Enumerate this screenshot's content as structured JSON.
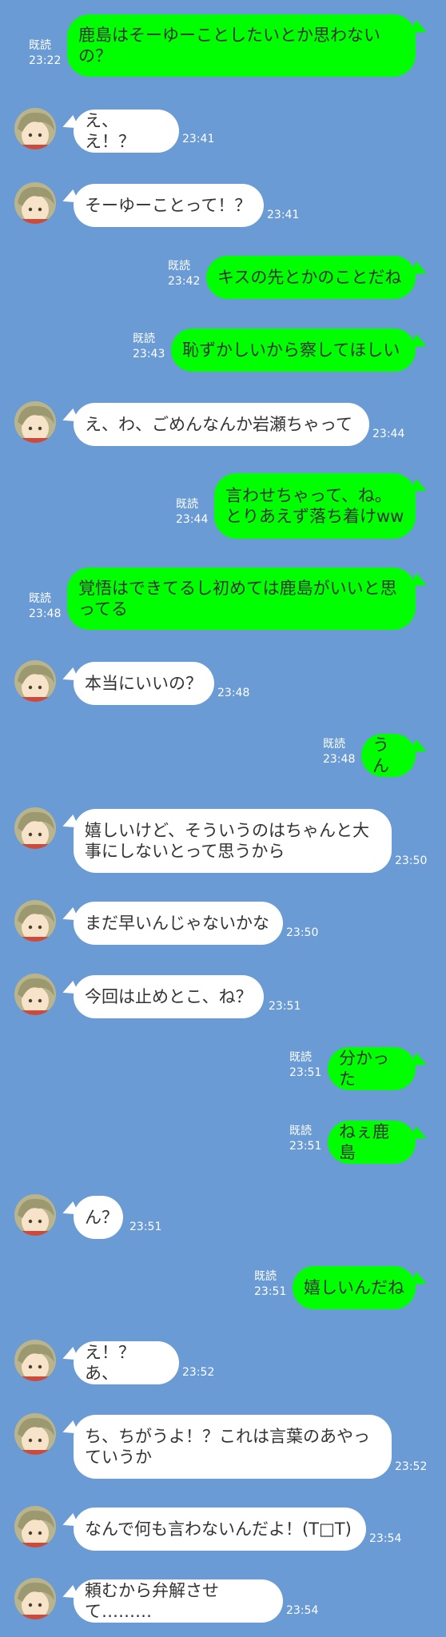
{
  "theme": {
    "background": "#6a9bd4",
    "outgoing_bubble": "#00ff00",
    "incoming_bubble": "#ffffff",
    "meta_text": "#ffffff"
  },
  "messages": [
    {
      "side": "out",
      "text": "鹿島はそーゆーことしたいとか思わないの？",
      "read": "既読",
      "time": "23:22"
    },
    {
      "side": "in",
      "text": "え、え！？",
      "time": "23:41"
    },
    {
      "side": "in",
      "text": "そーゆーことって！？",
      "time": "23:41"
    },
    {
      "side": "out",
      "text": "キスの先とかのことだね",
      "read": "既読",
      "time": "23:42"
    },
    {
      "side": "out",
      "text": "恥ずかしいから察してほしい",
      "read": "既読",
      "time": "23:43"
    },
    {
      "side": "in",
      "text": "え、わ、ごめんなんか岩瀬ちゃって",
      "time": "23:44"
    },
    {
      "side": "out",
      "text": "言わせちゃって、ね。\nとりあえず落ち着けww",
      "read": "既読",
      "time": "23:44"
    },
    {
      "side": "out",
      "text": "覚悟はできてるし初めては鹿島がいいと思ってる",
      "read": "既読",
      "time": "23:48"
    },
    {
      "side": "in",
      "text": "本当にいいの？",
      "time": "23:48"
    },
    {
      "side": "out",
      "text": "うん",
      "read": "既読",
      "time": "23:48"
    },
    {
      "side": "in",
      "text": "嬉しいけど、そういうのはちゃんと大事にしないとって思うから",
      "time": "23:50"
    },
    {
      "side": "in",
      "text": "まだ早いんじゃないかな",
      "time": "23:50"
    },
    {
      "side": "in",
      "text": "今回は止めとこ、ね？",
      "time": "23:51"
    },
    {
      "side": "out",
      "text": "分かった",
      "read": "既読",
      "time": "23:51"
    },
    {
      "side": "out",
      "text": "ねぇ鹿島",
      "read": "既読",
      "time": "23:51"
    },
    {
      "side": "in",
      "text": "ん？",
      "time": "23:51"
    },
    {
      "side": "out",
      "text": "嬉しいんだね",
      "read": "既読",
      "time": "23:51"
    },
    {
      "side": "in",
      "text": "え！？あ、",
      "time": "23:52"
    },
    {
      "side": "in",
      "text": "ち、ちがうよ！？これは言葉のあやっていうか",
      "time": "23:52"
    },
    {
      "side": "in",
      "text": "なんで何も言わないんだよ！(T□T)",
      "time": "23:54"
    },
    {
      "side": "in",
      "text": "頼むから弁解させて………",
      "time": "23:54"
    }
  ]
}
